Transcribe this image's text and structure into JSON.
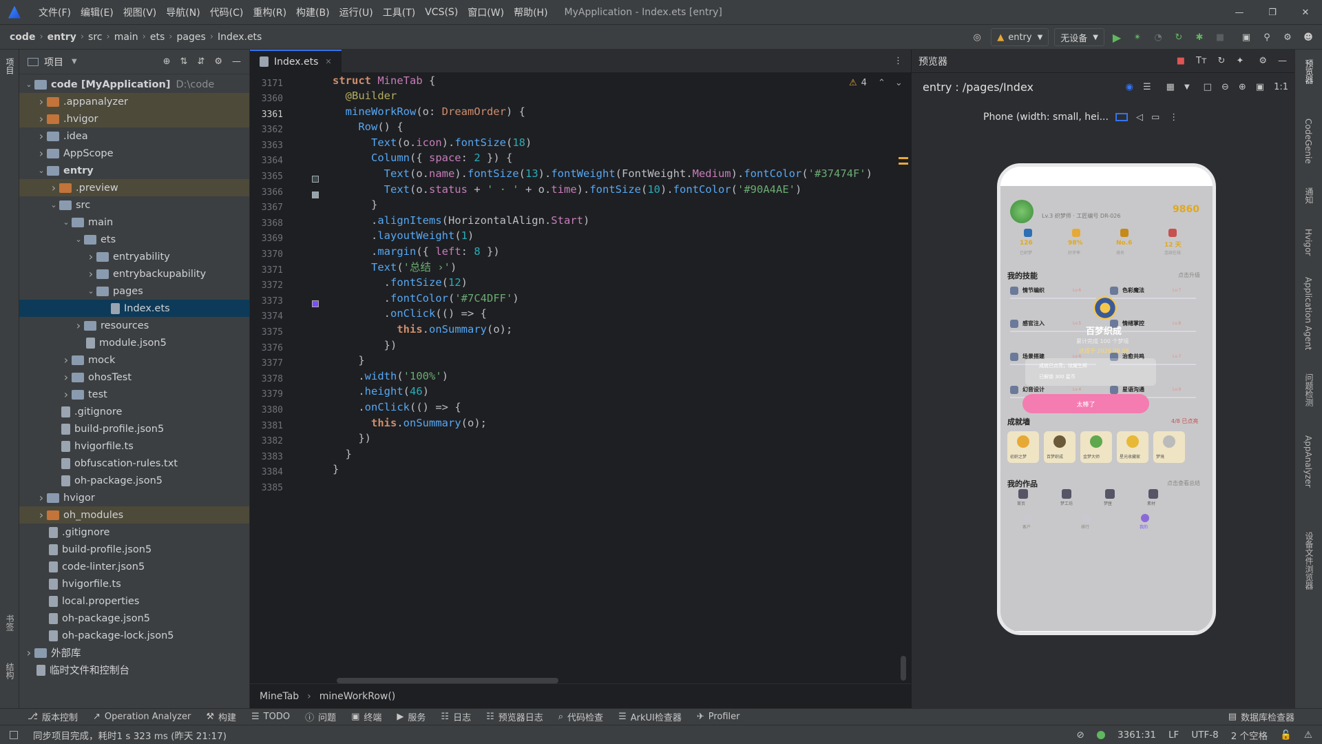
{
  "menu": [
    "文件(F)",
    "编辑(E)",
    "视图(V)",
    "导航(N)",
    "代码(C)",
    "重构(R)",
    "构建(B)",
    "运行(U)",
    "工具(T)",
    "VCS(S)",
    "窗口(W)",
    "帮助(H)"
  ],
  "window_title": "MyApplication - Index.ets [entry]",
  "breadcrumb": [
    "code",
    "entry",
    "src",
    "main",
    "ets",
    "pages",
    "Index.ets"
  ],
  "toolbar": {
    "module": "entry",
    "device": "无设备"
  },
  "project_panel": {
    "title": "项目"
  },
  "tree": [
    {
      "label": "code [MyApplication]",
      "extra": "D:\\code",
      "depth": 0,
      "open": true,
      "kind": "folder",
      "bold": true
    },
    {
      "label": ".appanalyzer",
      "depth": 1,
      "kind": "folder-o",
      "hl": true
    },
    {
      "label": ".hvigor",
      "depth": 1,
      "kind": "folder-o",
      "hl": true
    },
    {
      "label": ".idea",
      "depth": 1,
      "kind": "folder"
    },
    {
      "label": "AppScope",
      "depth": 1,
      "kind": "folder"
    },
    {
      "label": "entry",
      "depth": 1,
      "open": true,
      "kind": "folder",
      "bold": true
    },
    {
      "label": ".preview",
      "depth": 2,
      "kind": "folder-o",
      "hl": true
    },
    {
      "label": "src",
      "depth": 2,
      "open": true,
      "kind": "folder"
    },
    {
      "label": "main",
      "depth": 3,
      "open": true,
      "kind": "folder"
    },
    {
      "label": "ets",
      "depth": 4,
      "open": true,
      "kind": "folder"
    },
    {
      "label": "entryability",
      "depth": 5,
      "kind": "folder"
    },
    {
      "label": "entrybackupability",
      "depth": 5,
      "kind": "folder"
    },
    {
      "label": "pages",
      "depth": 5,
      "open": true,
      "kind": "folder"
    },
    {
      "label": "Index.ets",
      "depth": 6,
      "kind": "file",
      "sel": true,
      "leaf": true
    },
    {
      "label": "resources",
      "depth": 4,
      "kind": "folder"
    },
    {
      "label": "module.json5",
      "depth": 4,
      "kind": "file",
      "leaf": true
    },
    {
      "label": "mock",
      "depth": 3,
      "kind": "folder"
    },
    {
      "label": "ohosTest",
      "depth": 3,
      "kind": "folder"
    },
    {
      "label": "test",
      "depth": 3,
      "kind": "folder"
    },
    {
      "label": ".gitignore",
      "depth": 2,
      "kind": "file",
      "leaf": true
    },
    {
      "label": "build-profile.json5",
      "depth": 2,
      "kind": "file",
      "leaf": true
    },
    {
      "label": "hvigorfile.ts",
      "depth": 2,
      "kind": "file",
      "leaf": true
    },
    {
      "label": "obfuscation-rules.txt",
      "depth": 2,
      "kind": "file",
      "leaf": true
    },
    {
      "label": "oh-package.json5",
      "depth": 2,
      "kind": "file",
      "leaf": true
    },
    {
      "label": "hvigor",
      "depth": 1,
      "kind": "folder"
    },
    {
      "label": "oh_modules",
      "depth": 1,
      "kind": "folder-o",
      "hl": true
    },
    {
      "label": ".gitignore",
      "depth": 1,
      "kind": "file",
      "leaf": true
    },
    {
      "label": "build-profile.json5",
      "depth": 1,
      "kind": "file",
      "leaf": true
    },
    {
      "label": "code-linter.json5",
      "depth": 1,
      "kind": "file",
      "leaf": true
    },
    {
      "label": "hvigorfile.ts",
      "depth": 1,
      "kind": "file",
      "leaf": true
    },
    {
      "label": "local.properties",
      "depth": 1,
      "kind": "file",
      "leaf": true
    },
    {
      "label": "oh-package.json5",
      "depth": 1,
      "kind": "file",
      "leaf": true
    },
    {
      "label": "oh-package-lock.json5",
      "depth": 1,
      "kind": "file",
      "leaf": true
    },
    {
      "label": "外部库",
      "depth": 0,
      "kind": "lib"
    },
    {
      "label": "临时文件和控制台",
      "depth": 0,
      "kind": "file",
      "leaf": true
    }
  ],
  "editor": {
    "tab": "Index.ets",
    "sticky_line": "3171",
    "warnings": "4",
    "lines": [
      "3360",
      "3361",
      "3362",
      "3363",
      "3364",
      "3365",
      "3366",
      "3367",
      "3368",
      "3369",
      "3370",
      "3371",
      "3372",
      "3373",
      "3374",
      "3375",
      "3376",
      "3377",
      "3378",
      "3379",
      "3380",
      "3381",
      "3382",
      "3383",
      "3384",
      "3385"
    ],
    "breadcrumb": [
      "MineTab",
      "mineWorkRow()"
    ]
  },
  "preview": {
    "panel_title": "预览器",
    "route": "entry : /pages/Index",
    "device": "Phone (width: small, hei...",
    "app": {
      "score": "9860",
      "subtitle": "Lv.3 织梦师 · 工匠编号 DR-026",
      "stats": [
        {
          "v": "126",
          "l": "已织梦"
        },
        {
          "v": "98%",
          "l": "好评率"
        },
        {
          "v": "No.6",
          "l": "排名"
        },
        {
          "v": "12 天",
          "l": "连续在线"
        }
      ],
      "skills_title": "我的技能",
      "skills_more": "点击升级",
      "skills": [
        {
          "n": "情节编织",
          "lv": "Lv.6"
        },
        {
          "n": "色彩魔法",
          "lv": "Lv.7"
        },
        {
          "n": "感官注入",
          "lv": "Lv.5"
        },
        {
          "n": "情绪掌控",
          "lv": "Lv.8"
        },
        {
          "n": "场景搭建",
          "lv": "Lv.6"
        },
        {
          "n": "治愈共鸣",
          "lv": "Lv.7"
        },
        {
          "n": "幻音设计",
          "lv": "Lv.4"
        },
        {
          "n": "星语沟通",
          "lv": "Lv.9"
        }
      ],
      "dialog": {
        "title": "百梦织成",
        "desc": "累计完成 100 个梦境",
        "date": "达成于 2026.08.08",
        "items": [
          "成就已点亮，炫耀生辉",
          "已解锁 300 星币"
        ],
        "button": "太棒了"
      },
      "achievements_title": "成就墙",
      "achievements_more": "4/8 已点亮",
      "achievements": [
        "初织之梦",
        "百梦织成",
        "金梦大师",
        "星光收藏家",
        "梦境"
      ],
      "works_title": "我的作品",
      "works_more": "点击查看总结",
      "nav": [
        "首页",
        "梦工坊",
        "梦匣",
        "素材"
      ],
      "nav2": [
        "客户",
        "排行",
        "我的"
      ]
    }
  },
  "right_tools": [
    "预览器",
    "CodeGenie",
    "通知",
    "Hvigor",
    "Application Agent",
    "问题检测",
    "AppAnalyzer",
    "设备文件浏览器"
  ],
  "left_tools": [
    "项目",
    "书签",
    "结构"
  ],
  "tool_windows": [
    "版本控制",
    "Operation Analyzer",
    "构建",
    "TODO",
    "问题",
    "终端",
    "服务",
    "日志",
    "预览器日志",
    "代码检查",
    "ArkUI检查器",
    "Profiler"
  ],
  "tool_windows_right": "数据库检查器",
  "status": {
    "message": "同步项目完成，耗时1 s 323 ms (昨天 21:17)",
    "position": "3361:31",
    "line_sep": "LF",
    "encoding": "UTF-8",
    "indent": "2 个空格"
  },
  "colors": {
    "accent": "#3574f0",
    "pink": "#f47cb1",
    "gold": "#e7a936"
  }
}
